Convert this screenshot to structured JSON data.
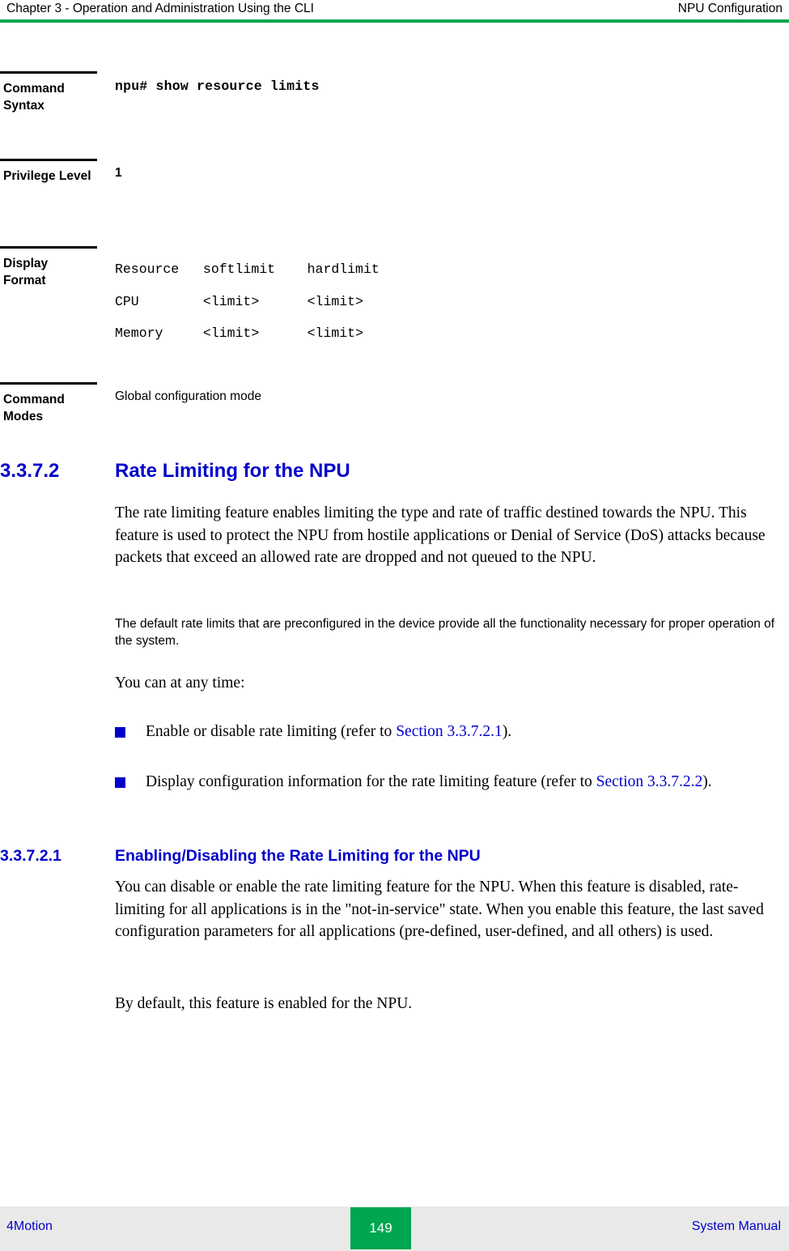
{
  "header": {
    "left": "Chapter 3 - Operation and Administration Using the CLI",
    "right": "NPU Configuration"
  },
  "command_table": {
    "rows": [
      {
        "label": "Command Syntax",
        "value": "npu# show resource limits"
      },
      {
        "label": "Privilege Level",
        "value": "1"
      },
      {
        "label": "Display Format",
        "line1": "Resource   softlimit    hardlimit",
        "line2": "CPU        <limit>      <limit>",
        "line3": "Memory     <limit>      <limit>"
      },
      {
        "label": "Command Modes",
        "value": "Global configuration mode"
      }
    ]
  },
  "sections": {
    "s1": {
      "number": "3.3.7.2",
      "title": "Rate Limiting for the NPU",
      "para1": "The rate limiting feature enables limiting the type and rate of traffic destined towards the NPU. This feature is used to protect the NPU from hostile applications or Denial of Service (DoS) attacks because packets that exceed an allowed rate are dropped and not queued to the NPU.",
      "para2": "The default rate limits that are preconfigured in the device provide all the functionality necessary for proper operation of the system.",
      "para3": "You can at any time:",
      "bullet1_pre": "Enable or disable rate limiting (refer to ",
      "bullet1_link": "Section 3.3.7.2.1",
      "bullet1_post": ").",
      "bullet2_pre": "Display configuration information for the rate limiting feature (refer to ",
      "bullet2_link": "Section 3.3.7.2.2",
      "bullet2_post": ")."
    },
    "s2": {
      "number": "3.3.7.2.1",
      "title": "Enabling/Disabling the Rate Limiting for the NPU",
      "para1": "You can disable or enable the rate limiting feature for the NPU. When this feature is disabled, rate-limiting for all applications is in the \"not-in-service\" state. When you enable this feature, the last saved configuration parameters for all applications (pre-defined, user-defined, and all others) is used.",
      "para2": "By default, this feature is enabled for the NPU."
    }
  },
  "footer": {
    "left": "4Motion",
    "page": "149",
    "right": "System Manual"
  },
  "colors": {
    "accent_green": "#00a650",
    "heading_blue": "#0000cc",
    "footer_bg": "#e9e9e9"
  }
}
